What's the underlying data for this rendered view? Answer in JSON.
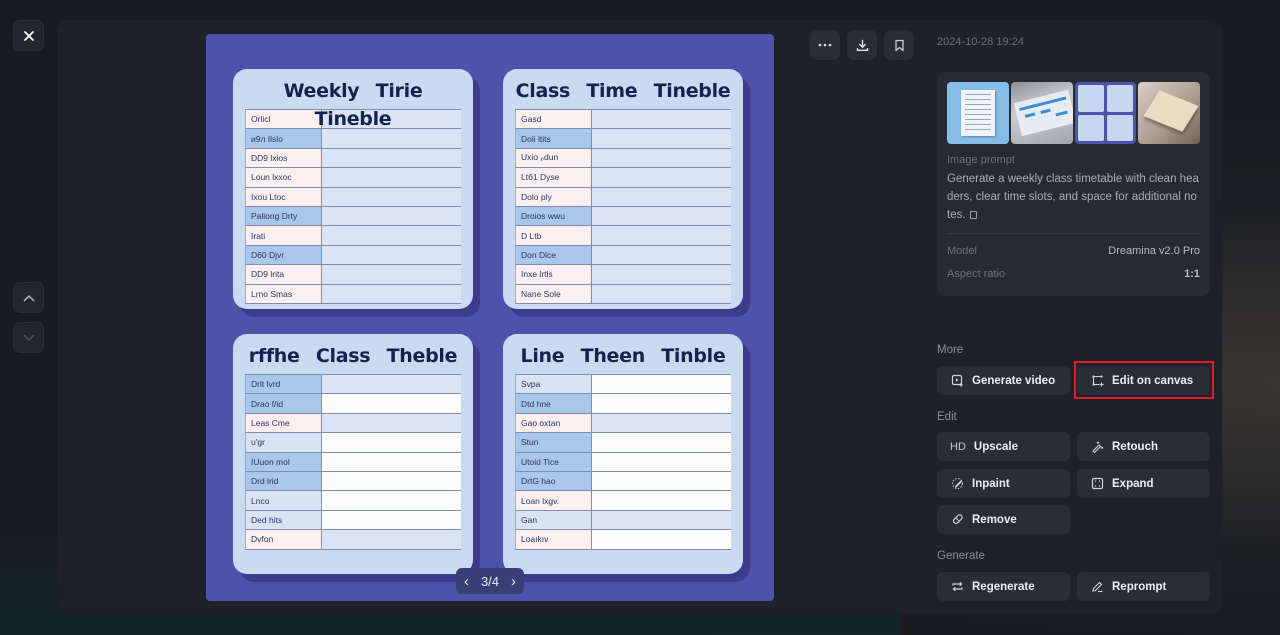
{
  "window": {
    "close_label": "Close",
    "nav_up_label": "Previous",
    "nav_down_label": "Next"
  },
  "preview": {
    "pager": {
      "current": 3,
      "total": 4,
      "text": "3/4",
      "prev_icon": "chevron-left-icon",
      "next_icon": "chevron-right-icon"
    },
    "timetables": [
      {
        "title": "Weekly Tirie Tineble",
        "rows": [
          {
            "label": "Orlicl",
            "style": "pink",
            "value_style": "val"
          },
          {
            "label": "и9л Ilslo",
            "style": "blue",
            "value_style": "val"
          },
          {
            "label": "DD9 lxios",
            "style": "pink",
            "value_style": "val"
          },
          {
            "label": "Loun lxxoc",
            "style": "pink",
            "value_style": "val"
          },
          {
            "label": "Ixou Ltoc",
            "style": "pink",
            "value_style": "val"
          },
          {
            "label": "Paliong Drtу",
            "style": "blue",
            "value_style": "val"
          },
          {
            "label": "Irati",
            "style": "pink",
            "value_style": "val"
          },
          {
            "label": "D60 Dјvr",
            "style": "blue",
            "value_style": "val"
          },
          {
            "label": "DD9 lrita",
            "style": "pink",
            "value_style": "val"
          },
          {
            "label": "Lrno Smas",
            "style": "pink",
            "value_style": "val"
          }
        ]
      },
      {
        "title": "Class Time Tineble",
        "rows": [
          {
            "label": "Gasd",
            "style": "pink",
            "value_style": "val"
          },
          {
            "label": "Doli ltits",
            "style": "blue",
            "value_style": "val"
          },
          {
            "label": "Uxio ₚdun",
            "style": "pink",
            "value_style": "val"
          },
          {
            "label": "Ltб1 Dyse",
            "style": "pink",
            "value_style": "val"
          },
          {
            "label": "Dolo ply",
            "style": "pink",
            "value_style": "val"
          },
          {
            "label": "Droios wwu",
            "style": "blue",
            "value_style": "val"
          },
          {
            "label": "D Ltb",
            "style": "pink",
            "value_style": "val"
          },
          {
            "label": "Don Dlce",
            "style": "blue",
            "value_style": "val"
          },
          {
            "label": "Inxe lrtls",
            "style": "pink",
            "value_style": "val"
          },
          {
            "label": "Nane Sole",
            "style": "pink",
            "value_style": "val"
          }
        ]
      },
      {
        "title": "rffhe Class Theble",
        "rows": [
          {
            "label": "Drlt lvrd",
            "style": "blue",
            "value_style": "val"
          },
          {
            "label": "Drao f/id",
            "style": "blue",
            "value_style": "white"
          },
          {
            "label": "Leas Cme",
            "style": "pink",
            "value_style": "val"
          },
          {
            "label": "u'gr",
            "style": "lite",
            "value_style": "white"
          },
          {
            "label": "IUuon mol",
            "style": "blue",
            "value_style": "white"
          },
          {
            "label": "Drd lrid",
            "style": "blue",
            "value_style": "white"
          },
          {
            "label": "Lnco",
            "style": "lite",
            "value_style": "white"
          },
          {
            "label": "Ded hits",
            "style": "lite",
            "value_style": "white"
          },
          {
            "label": "Dvfon",
            "style": "pink",
            "value_style": "val"
          }
        ]
      },
      {
        "title": "Line Theen Tinble",
        "rows": [
          {
            "label": "Svpa",
            "style": "lite",
            "value_style": "white"
          },
          {
            "label": "Dtd hne",
            "style": "blue",
            "value_style": "white"
          },
          {
            "label": "Gao oxtan",
            "style": "pink",
            "value_style": "val"
          },
          {
            "label": "Stun",
            "style": "blue",
            "value_style": "white"
          },
          {
            "label": "Utoid Tice",
            "style": "blue",
            "value_style": "white"
          },
          {
            "label": "DrtG hao",
            "style": "blue",
            "value_style": "white"
          },
          {
            "label": "Loan lxgv.",
            "style": "pink",
            "value_style": "white"
          },
          {
            "label": "Gan",
            "style": "lite",
            "value_style": "val"
          },
          {
            "label": "Loaıkıv",
            "style": "pink",
            "value_style": "white"
          }
        ]
      }
    ]
  },
  "toolbar": {
    "more_icon": "more-horizontal-icon",
    "download_icon": "download-icon",
    "bookmark_icon": "bookmark-icon"
  },
  "details": {
    "timestamp": "2024-10-28 19:24",
    "thumbnails": [
      {
        "name": "timetable-paper-blue"
      },
      {
        "name": "timetable-sheet-grey"
      },
      {
        "name": "timetable-grid-purple",
        "selected": true
      },
      {
        "name": "timetable-card-beige"
      }
    ],
    "prompt_label": "Image prompt",
    "prompt_text": "Generate a weekly class timetable with clean headers, clear time slots, and space for additional notes.",
    "model_label": "Model",
    "model_value": "Dreamina v2.0 Pro",
    "aspect_label": "Aspect ratio",
    "aspect_value": "1:1"
  },
  "sections": {
    "more": {
      "label": "More",
      "buttons": [
        {
          "label": "Generate video",
          "icon": "video-add-icon"
        },
        {
          "label": "Edit on canvas",
          "icon": "canvas-edit-icon",
          "highlighted": true
        }
      ]
    },
    "edit": {
      "label": "Edit",
      "buttons": [
        {
          "label": "Upscale",
          "icon_text": "HD"
        },
        {
          "label": "Retouch",
          "icon": "magic-wand-icon"
        },
        {
          "label": "Inpaint",
          "icon": "inpaint-brush-icon"
        },
        {
          "label": "Expand",
          "icon": "expand-icon"
        },
        {
          "label": "Remove",
          "icon": "eraser-icon"
        }
      ]
    },
    "generate": {
      "label": "Generate",
      "buttons": [
        {
          "label": "Regenerate",
          "icon": "regenerate-icon"
        },
        {
          "label": "Reprompt",
          "icon": "pencil-icon"
        }
      ]
    }
  },
  "colors": {
    "accent_highlight": "#e11d24",
    "image_background": "#4f52ab",
    "panel_background": "#1f2128",
    "button_background": "#2a2d35"
  }
}
